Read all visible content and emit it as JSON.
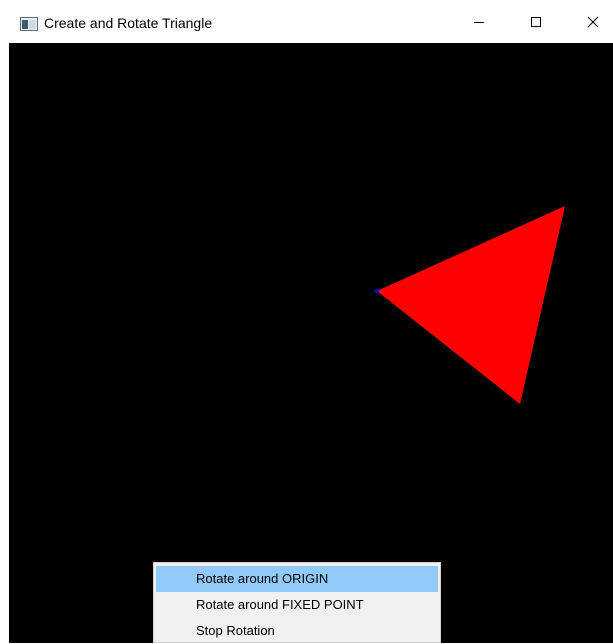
{
  "window": {
    "title": "Create and Rotate Triangle",
    "icon": "app-window-icon",
    "controls": {
      "minimize_icon": "minimize-icon",
      "maximize_icon": "maximize-icon",
      "close_icon": "close-icon"
    }
  },
  "canvas": {
    "background_color": "#000000",
    "triangle_color": "#ff0000",
    "fixed_point_color": "#0000ff"
  },
  "context_menu": {
    "items": [
      {
        "label": "Rotate around ORIGIN",
        "highlighted": true
      },
      {
        "label": "Rotate around FIXED POINT",
        "highlighted": false
      },
      {
        "label": "Stop Rotation",
        "highlighted": false
      }
    ],
    "highlight_color": "#91c9f7"
  }
}
